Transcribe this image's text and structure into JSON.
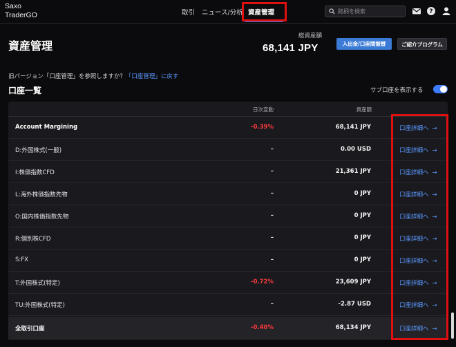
{
  "app": {
    "logo_line1": "Saxo",
    "logo_line2": "TraderGO"
  },
  "nav": {
    "trade": "取引",
    "news": "ニュース/分析",
    "assets": "資産管理"
  },
  "search": {
    "placeholder": "銘柄を検索"
  },
  "header": {
    "title": "資産管理",
    "total_label": "総資産額",
    "total_value": "68,141 JPY",
    "deposit_button": "入出金/口座間振替",
    "referral_button": "ご紹介プログラム"
  },
  "notice": {
    "text": "旧バージョン「口座管理」を参照しますか？",
    "link": "「口座管理」に戻す"
  },
  "accounts": {
    "title": "口座一覧",
    "toggle_label": "サブ口座を表示する",
    "toggle_on": true,
    "col_change": "日次変動",
    "col_assets": "資産額",
    "rows": [
      {
        "name": "Account Margining",
        "change": "-0.39%",
        "assets": "68,141 JPY",
        "link": "口座詳細へ"
      },
      {
        "name": "D:外国株式(一般)",
        "change": "–",
        "assets": "0.00 USD",
        "link": "口座詳細へ"
      },
      {
        "name": "I:株価指数CFD",
        "change": "–",
        "assets": "21,361 JPY",
        "link": "口座詳細へ"
      },
      {
        "name": "L:海外株価指数先物",
        "change": "–",
        "assets": "0 JPY",
        "link": "口座詳細へ"
      },
      {
        "name": "O:国内株価指数先物",
        "change": "–",
        "assets": "0 JPY",
        "link": "口座詳細へ"
      },
      {
        "name": "R:個別株CFD",
        "change": "–",
        "assets": "0 JPY",
        "link": "口座詳細へ"
      },
      {
        "name": "S:FX",
        "change": "–",
        "assets": "0 JPY",
        "link": "口座詳細へ"
      },
      {
        "name": "T:外国株式(特定)",
        "change": "-0.72%",
        "assets": "23,609 JPY",
        "link": "口座詳細へ"
      },
      {
        "name": "TU:外国株式(特定)",
        "change": "–",
        "assets": "-2.87 USD",
        "link": "口座詳細へ"
      }
    ],
    "total": {
      "name": "全取引口座",
      "change": "-0.40%",
      "assets": "68,134 JPY",
      "link": "口座詳細へ"
    }
  },
  "colors": {
    "accent": "#3d7cff",
    "negative": "#ff3b3b",
    "highlight": "#e01010"
  },
  "icons": {
    "search": "search-icon",
    "mail": "mail-icon",
    "help": "help-icon",
    "user": "user-icon",
    "arrow": "arrow-right-icon"
  }
}
